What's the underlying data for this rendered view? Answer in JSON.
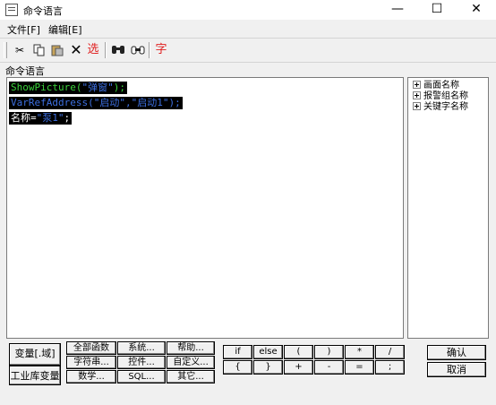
{
  "window": {
    "title": "命令语言",
    "minimize": "—",
    "maximize": "☐",
    "close": "✕"
  },
  "menu": {
    "items": [
      "文件[F]",
      "编辑[E]"
    ]
  },
  "toolbar": {
    "cut": "✂",
    "copy": "⎘",
    "paste": "📋",
    "delete": "✕",
    "select": "选",
    "find": "⌕",
    "replace": "⌕",
    "font": "字"
  },
  "section_label": "命令语言",
  "editor": {
    "lines": [
      {
        "fn": "ShowPicture(",
        "arg": "\"弹窗\"",
        "end": ");"
      },
      {
        "fn": "VarRefAddress(",
        "arg": "\"启动\",\"启动1\"",
        "end": ");"
      },
      {
        "fn": "名称=",
        "arg": "\"泵1\"",
        "end": ";"
      }
    ]
  },
  "tree": {
    "items": [
      "画面名称",
      "报警组名称",
      "关键字名称"
    ]
  },
  "buttons": {
    "var_domain": "变量[.域]",
    "ind_var": "工业库变量",
    "all_funcs": "全部函数",
    "system": "系统...",
    "help": "帮助...",
    "string": "字符串...",
    "control": "控件...",
    "custom": "自定义...",
    "math": "数学...",
    "sql": "SQL...",
    "other": "其它...",
    "ops_row1": [
      "if",
      "else",
      "(",
      ")",
      "*",
      "/"
    ],
    "ops_row2": [
      "{",
      "}",
      "+",
      "-",
      "=",
      ";"
    ],
    "ok": "确认",
    "cancel": "取消"
  }
}
